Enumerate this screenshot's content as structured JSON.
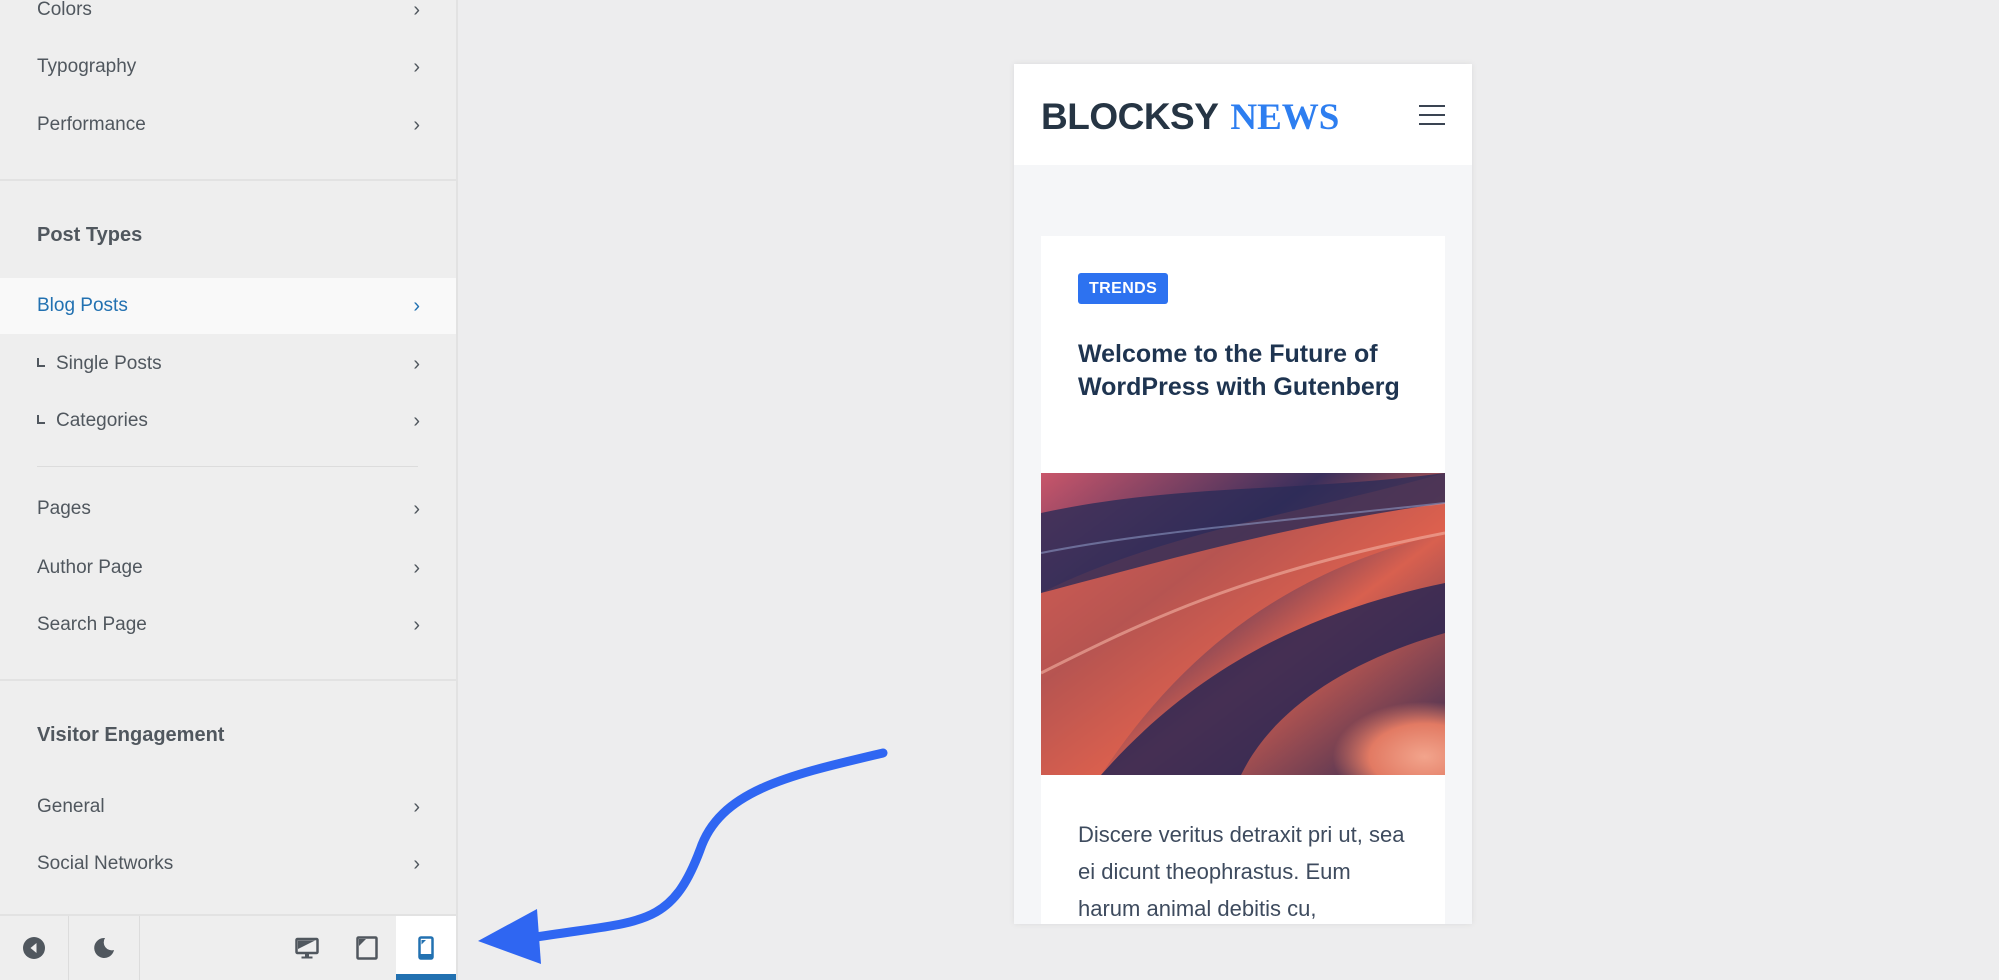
{
  "sidebar": {
    "general_items": [
      {
        "label": "Colors"
      },
      {
        "label": "Typography"
      },
      {
        "label": "Performance"
      }
    ],
    "post_types": {
      "title": "Post Types",
      "items": [
        {
          "label": "Blog Posts",
          "active": true
        },
        {
          "label": "Single Posts",
          "sub": true
        },
        {
          "label": "Categories",
          "sub": true
        },
        {
          "label": "Pages"
        },
        {
          "label": "Author Page"
        },
        {
          "label": "Search Page"
        }
      ]
    },
    "visitor_engagement": {
      "title": "Visitor Engagement",
      "items": [
        {
          "label": "General"
        },
        {
          "label": "Social Networks"
        }
      ]
    },
    "chevron": "›",
    "footer": {
      "buttons": [
        {
          "icon": "back-icon"
        },
        {
          "icon": "moon-icon"
        },
        {
          "icon": "desktop-icon"
        },
        {
          "icon": "tablet-icon"
        },
        {
          "icon": "mobile-icon",
          "active": true
        }
      ]
    }
  },
  "preview": {
    "logo_primary": "BLOCKSY",
    "logo_secondary": "NEWS",
    "post": {
      "category": "TRENDS",
      "title": "Welcome to the Future of WordPress with Gutenberg",
      "excerpt": "Discere veritus detraxit pri ut, sea ei dicunt theophrastus. Eum harum animal debitis cu,"
    }
  },
  "colors": {
    "accent_admin": "#2271b1",
    "accent_brand": "#2d72f0",
    "annotation_arrow": "#2f66f2"
  }
}
